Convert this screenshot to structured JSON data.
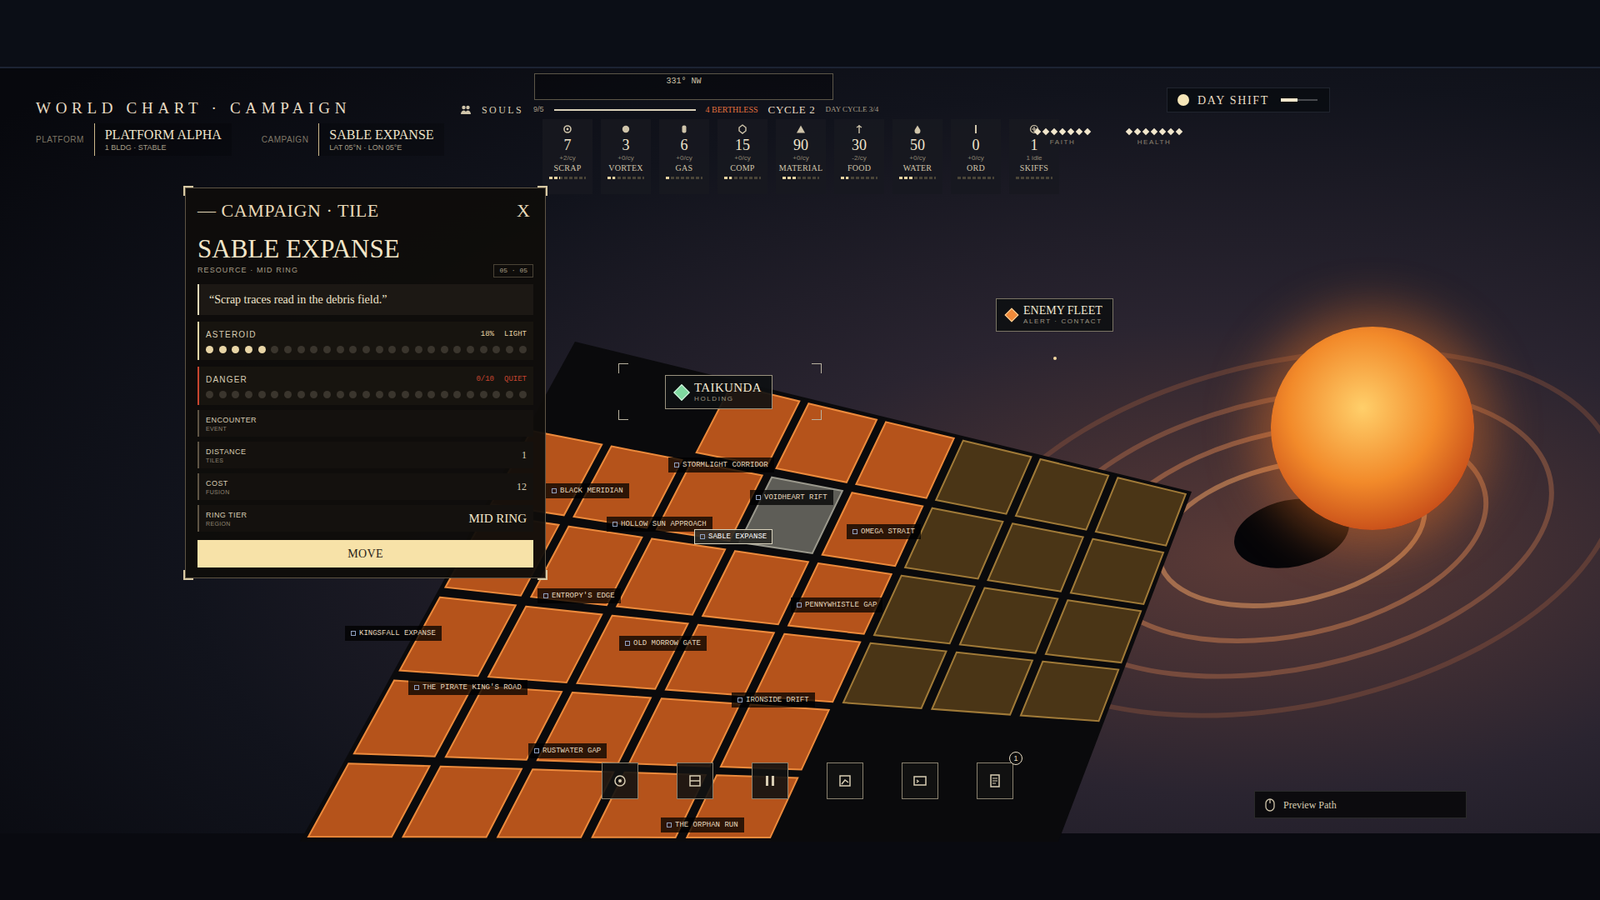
{
  "header": {
    "title": "WORLD CHART · CAMPAIGN",
    "platform_label": "PLATFORM",
    "platform": {
      "name": "PLATFORM ALPHA",
      "sub": "1 BLDG · STABLE"
    },
    "campaign_label": "CAMPAIGN",
    "campaign": {
      "name": "SABLE EXPANSE",
      "sub": "LAT 05°N · LON 05°E"
    }
  },
  "status": {
    "souls_label": "SOULS",
    "souls_value": "9/5",
    "souls_level": 1,
    "berthless": "4 BERTHLESS",
    "cycle": "CYCLE 2",
    "day_cycle": "DAY CYCLE 3/4"
  },
  "compass": {
    "heading": "331° NW"
  },
  "resources": [
    {
      "label": "SCRAP",
      "value": "7",
      "rate": "+2/cy",
      "level": 0.3
    },
    {
      "label": "VORTEX",
      "value": "3",
      "rate": "+0/cy",
      "level": 0.2
    },
    {
      "label": "GAS",
      "value": "6",
      "rate": "+0/cy",
      "level": 0.1
    },
    {
      "label": "COMP",
      "value": "15",
      "rate": "+0/cy",
      "level": 0.2
    },
    {
      "label": "MATERIAL",
      "value": "90",
      "rate": "+0/cy",
      "level": 0.4
    },
    {
      "label": "FOOD",
      "value": "30",
      "rate": "-2/cy",
      "level": 0.2
    },
    {
      "label": "WATER",
      "value": "50",
      "rate": "+0/cy",
      "level": 0.4
    },
    {
      "label": "ORD",
      "value": "0",
      "rate": "+0/cy",
      "level": 0
    },
    {
      "label": "SKIFFS",
      "value": "1",
      "rate": "1 idle",
      "level": 0
    }
  ],
  "gauges": [
    {
      "label": "FAITH",
      "stars": 7
    },
    {
      "label": "HEALTH",
      "stars": 7
    }
  ],
  "day_shift": {
    "label": "DAY SHIFT",
    "on": true
  },
  "tile_panel": {
    "header": "— CAMPAIGN · TILE",
    "close": "X",
    "title": "SABLE EXPANSE",
    "subtitle": "RESOURCE · MID RING",
    "coords": "05 · 05",
    "quote": "“Scrap traces read in the debris field.”",
    "meters": [
      {
        "label": "ASTEROID",
        "reading": "18%",
        "tag": "LIGHT",
        "level": 0.18,
        "color": "#e9d6a6"
      },
      {
        "label": "DANGER",
        "reading": "0/10",
        "tag": "QUIET",
        "level": 0,
        "color": "#c8452f"
      }
    ],
    "rows": [
      {
        "label": "ENCOUNTER",
        "sub": "EVENT"
      },
      {
        "label": "DISTANCE",
        "sub": "TILES",
        "value": "1"
      },
      {
        "label": "COST",
        "sub": "FUSION",
        "value": "12"
      },
      {
        "label": "RING TIER",
        "sub": "REGION",
        "value": "MID RING"
      }
    ],
    "button": "MOVE"
  },
  "map": {
    "holding": {
      "name": "TAIKUNDA",
      "sub": "HOLDING"
    },
    "enemy": {
      "name": "ENEMY FLEET",
      "sub": "ALERT · CONTACT"
    },
    "tiles": [
      {
        "name": "STORMLIGHT CORRIDOR",
        "selected": false
      },
      {
        "name": "VOIDHEART RIFT",
        "selected": false
      },
      {
        "name": "BLACK MERIDIAN",
        "selected": false
      },
      {
        "name": "HOLLOW SUN APPROACH",
        "selected": false
      },
      {
        "name": "SABLE EXPANSE",
        "selected": true
      },
      {
        "name": "OMEGA STRAIT",
        "selected": false
      },
      {
        "name": "ENTROPY'S EDGE",
        "selected": false
      },
      {
        "name": "PENNYWHISTLE GAP",
        "selected": false
      },
      {
        "name": "OLD MORROW GATE",
        "selected": false
      },
      {
        "name": "KINGSFALL EXPANSE",
        "selected": false
      },
      {
        "name": "THE PIRATE KING'S ROAD",
        "selected": false
      },
      {
        "name": "IRONSIDE DRIFT",
        "selected": false
      },
      {
        "name": "RUSTWATER GAP",
        "selected": false
      },
      {
        "name": "THE ORPHAN RUN",
        "selected": false
      }
    ]
  },
  "toolbar": [
    {
      "kind": "crew"
    },
    {
      "kind": "storage"
    },
    {
      "kind": "pause"
    },
    {
      "kind": "chart"
    },
    {
      "kind": "terminal"
    },
    {
      "kind": "log",
      "badge": "1"
    }
  ],
  "preview_path": "Preview Path"
}
